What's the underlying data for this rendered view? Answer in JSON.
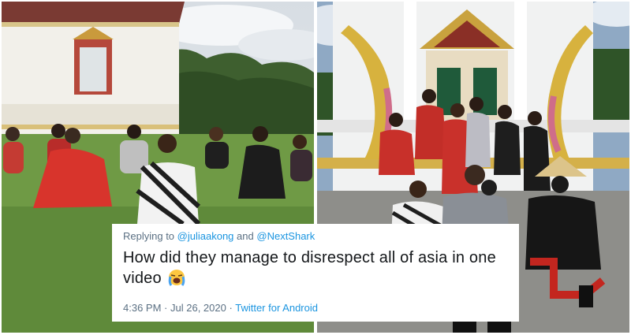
{
  "tweet": {
    "reply_prefix": "Replying to",
    "mention_1": "@juliaakong",
    "conjunction": "and",
    "mention_2": "@NextShark",
    "text": "How did they manage to disrespect all of asia in one video",
    "emoji": "loudly-crying-face-emoji",
    "time": "4:36 PM",
    "separator": "·",
    "date": "Jul 26, 2020",
    "source": "Twitter for Android"
  },
  "colors": {
    "link": "#1b95e0",
    "meta_gray": "#5b7083",
    "text": "#14171a"
  }
}
